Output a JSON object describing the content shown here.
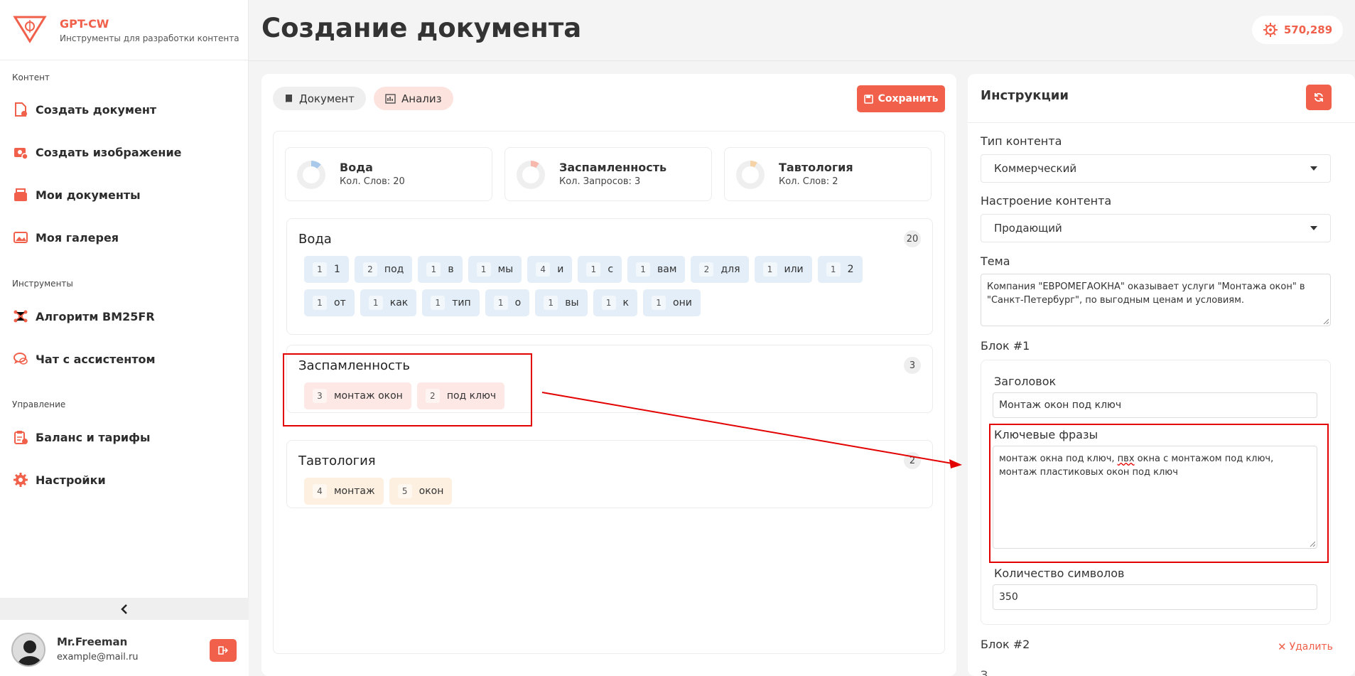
{
  "brand": {
    "name": "GPT-CW",
    "subtitle": "Инструменты для разработки контента"
  },
  "sidebar": {
    "sections": [
      "Контент",
      "Инструменты",
      "Управление"
    ],
    "items": [
      {
        "label": "Создать документ",
        "icon": "document-add-icon"
      },
      {
        "label": "Создать изображение",
        "icon": "image-add-icon"
      },
      {
        "label": "Мои документы",
        "icon": "documents-box-icon"
      },
      {
        "label": "Моя галерея",
        "icon": "gallery-icon"
      },
      {
        "label": "Алгоритм BM25FR",
        "icon": "molecule-icon"
      },
      {
        "label": "Чат с ассистентом",
        "icon": "chat-icon"
      },
      {
        "label": "Баланс и тарифы",
        "icon": "clipboard-icon"
      },
      {
        "label": "Настройки",
        "icon": "gear-icon"
      }
    ]
  },
  "user": {
    "name": "Mr.Freeman",
    "email": "example@mail.ru"
  },
  "header": {
    "title": "Создание документа",
    "balance": "570,289"
  },
  "tabs": {
    "document": "Документ",
    "analysis": "Анализ",
    "save": "Сохранить"
  },
  "stats": [
    {
      "title": "Вода",
      "sub": "Кол. Слов: 20"
    },
    {
      "title": "Заспамленность",
      "sub": "Кол. Запросов: 3"
    },
    {
      "title": "Тавтология",
      "sub": "Кол. Слов: 2"
    }
  ],
  "water": {
    "title": "Вода",
    "count": "20",
    "chips": [
      {
        "n": "1",
        "w": "1"
      },
      {
        "n": "2",
        "w": "под"
      },
      {
        "n": "1",
        "w": "в"
      },
      {
        "n": "1",
        "w": "мы"
      },
      {
        "n": "4",
        "w": "и"
      },
      {
        "n": "1",
        "w": "с"
      },
      {
        "n": "1",
        "w": "вам"
      },
      {
        "n": "2",
        "w": "для"
      },
      {
        "n": "1",
        "w": "или"
      },
      {
        "n": "1",
        "w": "2"
      },
      {
        "n": "1",
        "w": "от"
      },
      {
        "n": "1",
        "w": "как"
      },
      {
        "n": "1",
        "w": "тип"
      },
      {
        "n": "1",
        "w": "о"
      },
      {
        "n": "1",
        "w": "вы"
      },
      {
        "n": "1",
        "w": "к"
      },
      {
        "n": "1",
        "w": "они"
      }
    ]
  },
  "spam": {
    "title": "Заспамленность",
    "count": "3",
    "chips": [
      {
        "n": "3",
        "w": "монтаж окон"
      },
      {
        "n": "2",
        "w": "под ключ"
      }
    ]
  },
  "tautology": {
    "title": "Тавтология",
    "count": "2",
    "chips": [
      {
        "n": "4",
        "w": "монтаж"
      },
      {
        "n": "5",
        "w": "окон"
      }
    ]
  },
  "instructions": {
    "title": "Инструкции",
    "content_type_label": "Тип контента",
    "content_type": "Коммерческий",
    "mood_label": "Настроение контента",
    "mood": "Продающий",
    "topic_label": "Тема",
    "topic": "Компания \"ЕВРОМЕГАОКНА\" оказывает услуги \"Монтажа окон\" в \"Санкт-Петербург\", по выгодным ценам и условиям.",
    "block1_label": "Блок #1",
    "heading_label": "Заголовок",
    "heading": "Монтаж окон под ключ",
    "keyphrases_label": "Ключевые фразы",
    "keyphrases_a": "монтаж окна под ключ, ",
    "keyphrases_b": "пвх",
    "keyphrases_c": " окна с монтажом под ключ, монтаж пластиковых окон под ключ",
    "chars_label": "Количество символов",
    "chars": "350",
    "block2_label": "Блок #2",
    "delete": "Удалить",
    "next_label": "З"
  },
  "colors": {
    "accent": "#f0604a",
    "annotation": "#e30000"
  }
}
